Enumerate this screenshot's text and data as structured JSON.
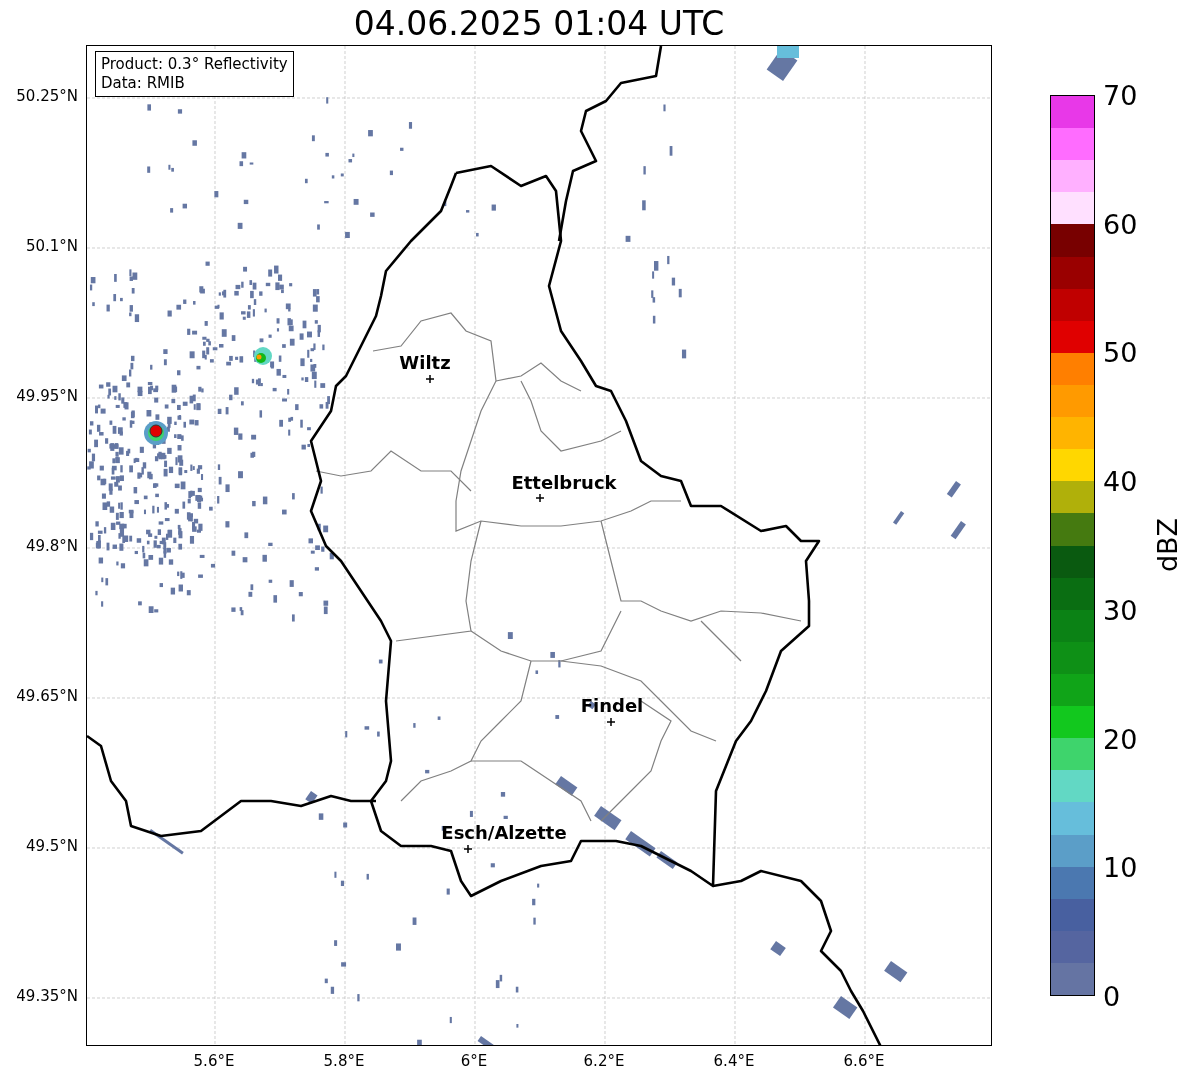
{
  "title": "04.06.2025 01:04 UTC",
  "info_box": {
    "lines": [
      "Product: 0.3° Reflectivity",
      "Data: RMIB"
    ]
  },
  "cities": [
    {
      "name": "Wiltz"
    },
    {
      "name": "Ettelbruck"
    },
    {
      "name": "Findel"
    },
    {
      "name": "Esch/Alzette"
    }
  ],
  "latitude_ticks": [
    "50.25°N",
    "50.1°N",
    "49.95°N",
    "49.8°N",
    "49.65°N",
    "49.5°N",
    "49.35°N"
  ],
  "longitude_ticks": [
    "5.6°E",
    "5.8°E",
    "6°E",
    "6.2°E",
    "6.4°E",
    "6.6°E"
  ],
  "colorbar": {
    "label": "dBZ",
    "ticks": [
      "70",
      "60",
      "50",
      "40",
      "30",
      "20",
      "10",
      "0"
    ],
    "segments": [
      {
        "color": "#e838e8"
      },
      {
        "color": "#ff6cff"
      },
      {
        "color": "#ffb0ff"
      },
      {
        "color": "#ffe0ff"
      },
      {
        "color": "#780000"
      },
      {
        "color": "#9a0000"
      },
      {
        "color": "#c00000"
      },
      {
        "color": "#e00000"
      },
      {
        "color": "#ff7f00"
      },
      {
        "color": "#ff9a00"
      },
      {
        "color": "#ffb400"
      },
      {
        "color": "#ffd700"
      },
      {
        "color": "#b0b00a"
      },
      {
        "color": "#457a10"
      },
      {
        "color": "#0a5a10"
      },
      {
        "color": "#0a6e12"
      },
      {
        "color": "#0b8215"
      },
      {
        "color": "#0e9016"
      },
      {
        "color": "#10a418"
      },
      {
        "color": "#12c81e"
      },
      {
        "color": "#3ed46c"
      },
      {
        "color": "#62d8c4"
      },
      {
        "color": "#66bedb"
      },
      {
        "color": "#5b9ec8"
      },
      {
        "color": "#4b78b0"
      },
      {
        "color": "#4860a0"
      },
      {
        "color": "#5565a0"
      },
      {
        "color": "#6574a3"
      }
    ]
  }
}
